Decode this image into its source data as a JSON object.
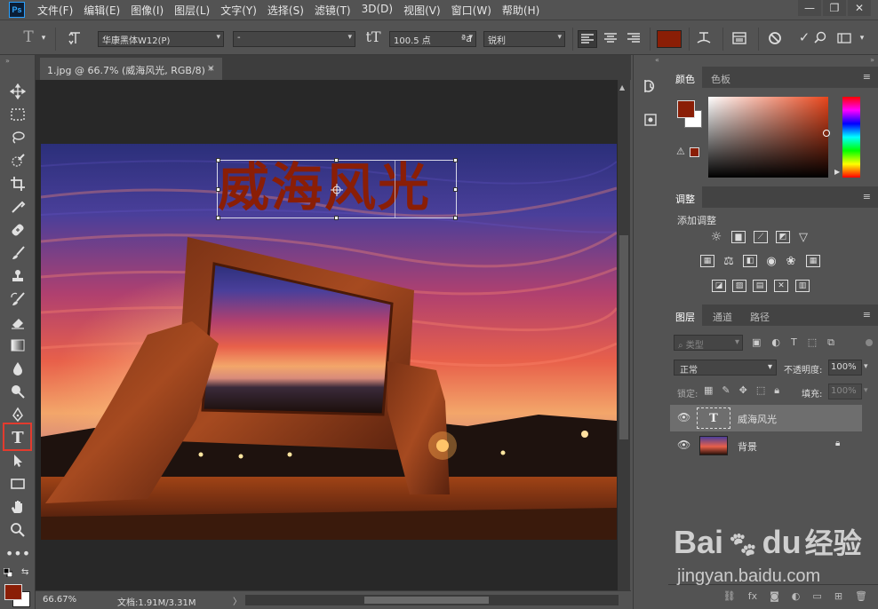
{
  "app": {
    "logo": "Ps"
  },
  "menu": [
    "文件(F)",
    "编辑(E)",
    "图像(I)",
    "图层(L)",
    "文字(Y)",
    "选择(S)",
    "滤镜(T)",
    "3D(D)",
    "视图(V)",
    "窗口(W)",
    "帮助(H)"
  ],
  "window_controls": {
    "minimize": "—",
    "restore": "❐",
    "close": "✕"
  },
  "options": {
    "font_family": "华康黑体W12(P)",
    "font_style": "-",
    "font_size": "100.5 点",
    "antialias": "锐利",
    "text_color": "#8a1e06"
  },
  "document": {
    "tab_title": "1.jpg @ 66.7% (威海风光, RGB/8) *",
    "tab_close": "×",
    "text_layer_content": "威海风光",
    "text_color": "#8a1e06"
  },
  "status": {
    "zoom": "66.67%",
    "doc_info": "文档:1.91M/3.31M",
    "arrow": "〉"
  },
  "color_panel": {
    "tabs": [
      "颜色",
      "色板"
    ],
    "foreground": "#8a1e06",
    "background": "#ffffff",
    "hue_base": "#e8461c"
  },
  "adjust_panel": {
    "tab": "调整",
    "title": "添加调整"
  },
  "layers_panel": {
    "tabs": [
      "图层",
      "通道",
      "路径"
    ],
    "filter_kind": "类型",
    "blend_mode": "正常",
    "opacity_label": "不透明度:",
    "opacity_value": "100%",
    "lock_label": "锁定:",
    "fill_label": "填充:",
    "fill_value": "100%",
    "layers": [
      {
        "name": "威海风光",
        "type": "text",
        "thumb_label": "T",
        "selected": true
      },
      {
        "name": "背景",
        "type": "image",
        "locked": true,
        "selected": false
      }
    ]
  },
  "watermark": {
    "brand_a": "Bai",
    "brand_b": "du",
    "brand_c": "经验",
    "url": "jingyan.baidu.com"
  }
}
